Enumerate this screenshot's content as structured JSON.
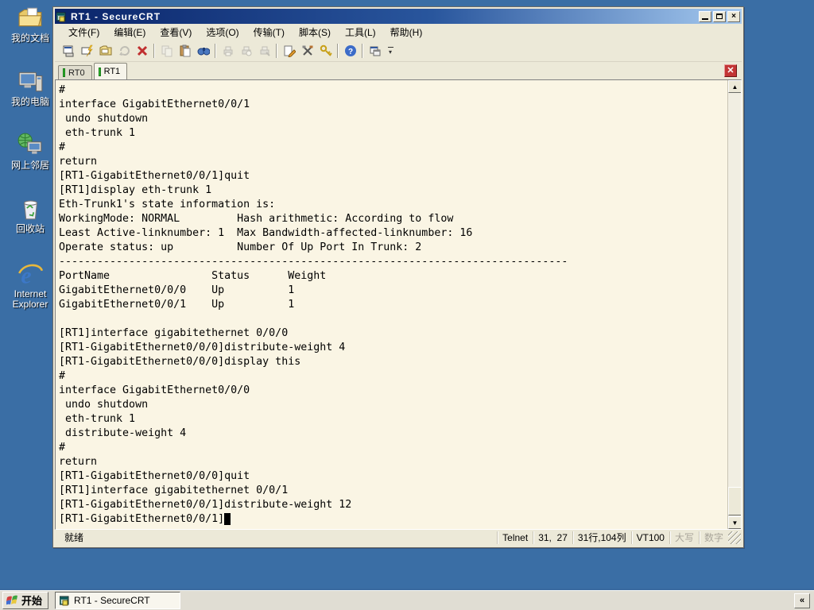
{
  "desktop": {
    "background_color": "#3A6EA5",
    "icons": [
      {
        "name": "my-documents",
        "label": "我的文档"
      },
      {
        "name": "my-computer",
        "label": "我的电脑"
      },
      {
        "name": "network-places",
        "label": "网上邻居"
      },
      {
        "name": "recycle-bin",
        "label": "回收站"
      },
      {
        "name": "internet-explorer",
        "label": "Internet Explorer"
      }
    ]
  },
  "window": {
    "title": "RT1 - SecureCRT",
    "menu": [
      "文件(F)",
      "编辑(E)",
      "查看(V)",
      "选项(O)",
      "传输(T)",
      "脚本(S)",
      "工具(L)",
      "帮助(H)"
    ],
    "toolbar_groups": [
      {
        "icons": [
          {
            "name": "connect",
            "disabled": false
          },
          {
            "name": "quick-connect",
            "disabled": false
          },
          {
            "name": "connect-in-tab",
            "disabled": false
          },
          {
            "name": "reconnect",
            "disabled": true
          },
          {
            "name": "disconnect",
            "disabled": false
          }
        ]
      },
      {
        "icons": [
          {
            "name": "copy",
            "disabled": true
          },
          {
            "name": "paste",
            "disabled": false
          },
          {
            "name": "find",
            "disabled": false
          }
        ]
      },
      {
        "icons": [
          {
            "name": "print",
            "disabled": true
          },
          {
            "name": "print-preview",
            "disabled": true
          },
          {
            "name": "print-setup",
            "disabled": true
          }
        ]
      },
      {
        "icons": [
          {
            "name": "session-options",
            "disabled": false
          },
          {
            "name": "global-options",
            "disabled": false
          },
          {
            "name": "keymap",
            "disabled": false
          }
        ]
      },
      {
        "icons": [
          {
            "name": "help",
            "disabled": false
          }
        ]
      },
      {
        "icons": [
          {
            "name": "session-manager",
            "disabled": false
          }
        ]
      }
    ],
    "tabs": [
      {
        "label": "RT0",
        "active": false
      },
      {
        "label": "RT1",
        "active": true
      }
    ],
    "terminal": {
      "background": "#FAF5E4",
      "cursor_row": 31,
      "lines": [
        "#",
        "interface GigabitEthernet0/0/1",
        " undo shutdown",
        " eth-trunk 1",
        "#",
        "return",
        "[RT1-GigabitEthernet0/0/1]quit",
        "[RT1]display eth-trunk 1",
        "Eth-Trunk1's state information is:",
        "WorkingMode: NORMAL         Hash arithmetic: According to flow",
        "Least Active-linknumber: 1  Max Bandwidth-affected-linknumber: 16",
        "Operate status: up          Number Of Up Port In Trunk: 2",
        "--------------------------------------------------------------------------------",
        "PortName                Status      Weight",
        "GigabitEthernet0/0/0    Up          1",
        "GigabitEthernet0/0/1    Up          1",
        "",
        "[RT1]interface gigabitethernet 0/0/0",
        "[RT1-GigabitEthernet0/0/0]distribute-weight 4",
        "[RT1-GigabitEthernet0/0/0]display this",
        "#",
        "interface GigabitEthernet0/0/0",
        " undo shutdown",
        " eth-trunk 1",
        " distribute-weight 4",
        "#",
        "return",
        "[RT1-GigabitEthernet0/0/0]quit",
        "[RT1]interface gigabitethernet 0/0/1",
        "[RT1-GigabitEthernet0/0/1]distribute-weight 12",
        "[RT1-GigabitEthernet0/0/1]"
      ]
    },
    "status_bar": {
      "ready": "就绪",
      "protocol": "Telnet",
      "cursor_pos": "31,  27",
      "size": "31行,104列",
      "emulation": "VT100",
      "caps": "大写",
      "num": "数字"
    }
  },
  "taskbar": {
    "start": "开始",
    "tasks": [
      {
        "label": "RT1 - SecureCRT",
        "active": true
      }
    ],
    "collapse": "«"
  }
}
